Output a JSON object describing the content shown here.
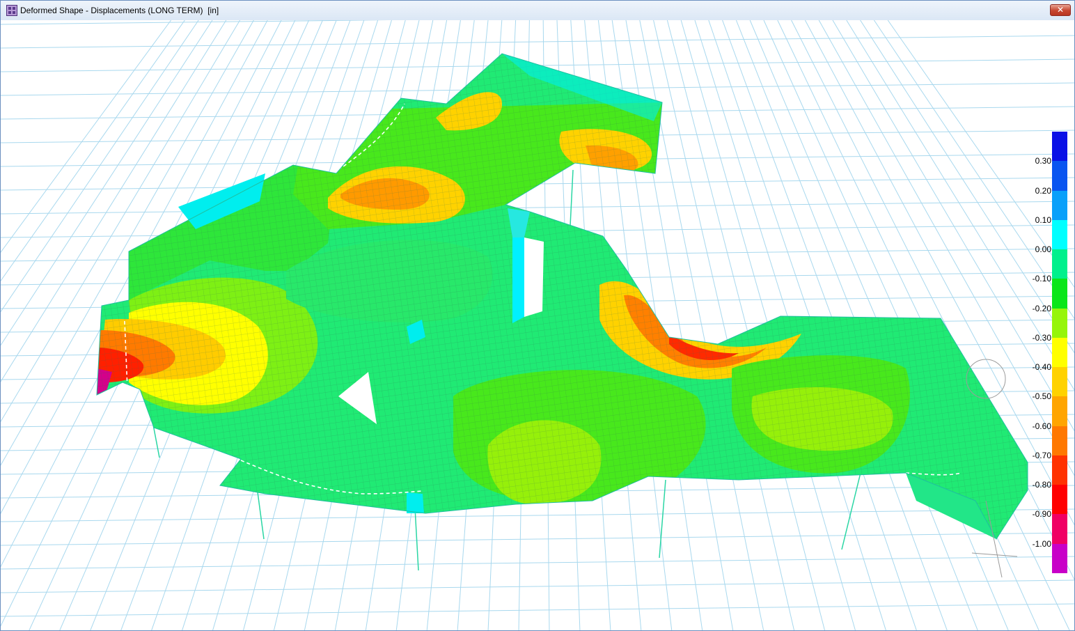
{
  "window": {
    "title": "Deformed Shape - Displacements (LONG TERM)  [in]",
    "close_label": "✕"
  },
  "legend": {
    "labels": [
      "0.30",
      "0.20",
      "0.10",
      "0.00",
      "-0.10",
      "-0.20",
      "-0.30",
      "-0.40",
      "-0.50",
      "-0.60",
      "-0.70",
      "-0.80",
      "-0.90",
      "-1.00"
    ],
    "colors": [
      "#0a10e6",
      "#0a55f0",
      "#0aa0fa",
      "#00ffff",
      "#00f08c",
      "#0ae619",
      "#96f50a",
      "#ffff00",
      "#ffd200",
      "#ffa500",
      "#ff7800",
      "#ff3200",
      "#ff0000",
      "#f00064",
      "#c800c8"
    ]
  },
  "colors": {
    "background": "#ffffff",
    "grid": "#a8d8ee",
    "mesh": "#3c7a5a",
    "column": "#2ad6a4"
  }
}
